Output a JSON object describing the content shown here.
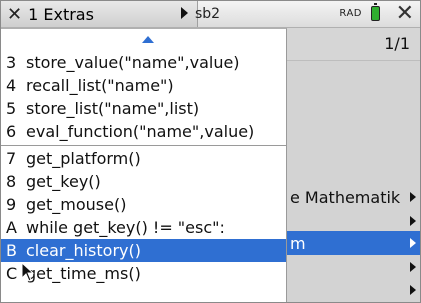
{
  "header": {
    "tab_title": "1 Extras",
    "doc_tab": "sb2",
    "mode": "RAD",
    "close_icon": "close-icon",
    "tools_icon": "tools-icon"
  },
  "page_indicator": "1/1",
  "menu": {
    "group1": [
      {
        "key": "3",
        "label": "store_value(\"name\",value)"
      },
      {
        "key": "4",
        "label": "recall_list(\"name\")"
      },
      {
        "key": "5",
        "label": "store_list(\"name\",list)"
      },
      {
        "key": "6",
        "label": "eval_function(\"name\",value)"
      }
    ],
    "group2": [
      {
        "key": "7",
        "label": "get_platform()"
      },
      {
        "key": "8",
        "label": "get_key()"
      },
      {
        "key": "9",
        "label": "get_mouse()"
      },
      {
        "key": "A",
        "label": "while get_key() != \"esc\":"
      },
      {
        "key": "B",
        "label": "clear_history()",
        "selected": true
      },
      {
        "key": "C",
        "label": "get_time_ms()"
      }
    ]
  },
  "right_menu": [
    {
      "label": "e Mathematik",
      "has_submenu": true
    },
    {
      "label": "",
      "has_submenu": true
    },
    {
      "label": "m",
      "has_submenu": true,
      "selected": true
    },
    {
      "label": "",
      "has_submenu": true
    },
    {
      "label": "",
      "has_submenu": true
    }
  ],
  "colors": {
    "accent": "#2f6fd2",
    "battery": "#2fae2f",
    "pane_bg": "#d3d3d3"
  }
}
